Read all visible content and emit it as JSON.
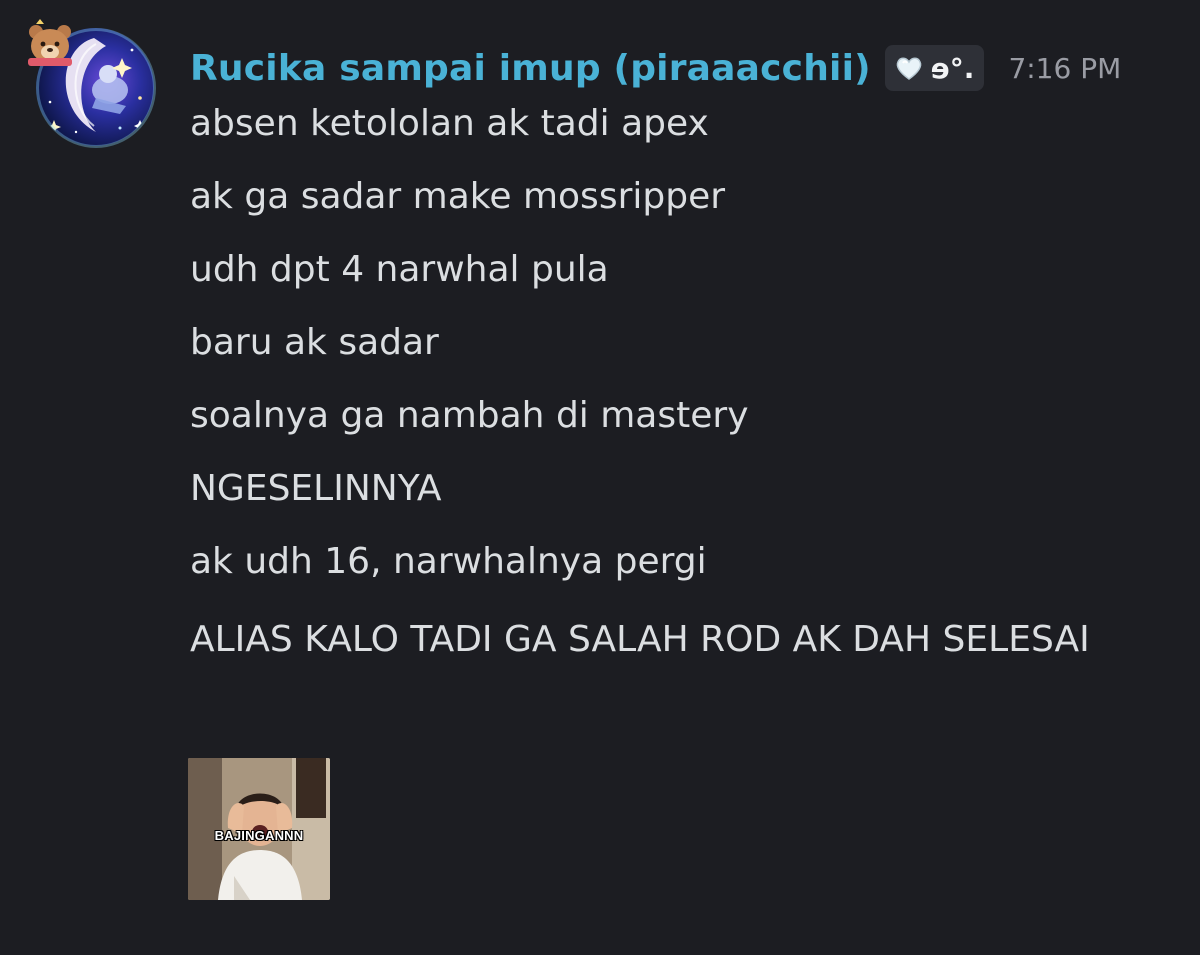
{
  "message": {
    "author": {
      "display_name": "Rucika sampai imup (piraaacchii)",
      "tag_text": "ɘ°.",
      "tag_icon": "white-heart-icon",
      "name_color": "#4ab2d6",
      "avatar_icon": "crescent-moon-avatar"
    },
    "timestamp": "7:16 PM",
    "lines": [
      "absen ketololan ak tadi apex",
      "ak ga sadar make mossripper",
      "udh dpt 4 narwhal pula",
      "baru ak sadar",
      "soalnya ga nambah di mastery",
      "NGESELINNYA",
      "ak udh 16, narwhalnya pergi",
      "ALIAS KALO TADI GA SALAH ROD AK DAH SELESAI"
    ],
    "attachment": {
      "type": "gif",
      "caption": "BAJINGANNN"
    }
  }
}
